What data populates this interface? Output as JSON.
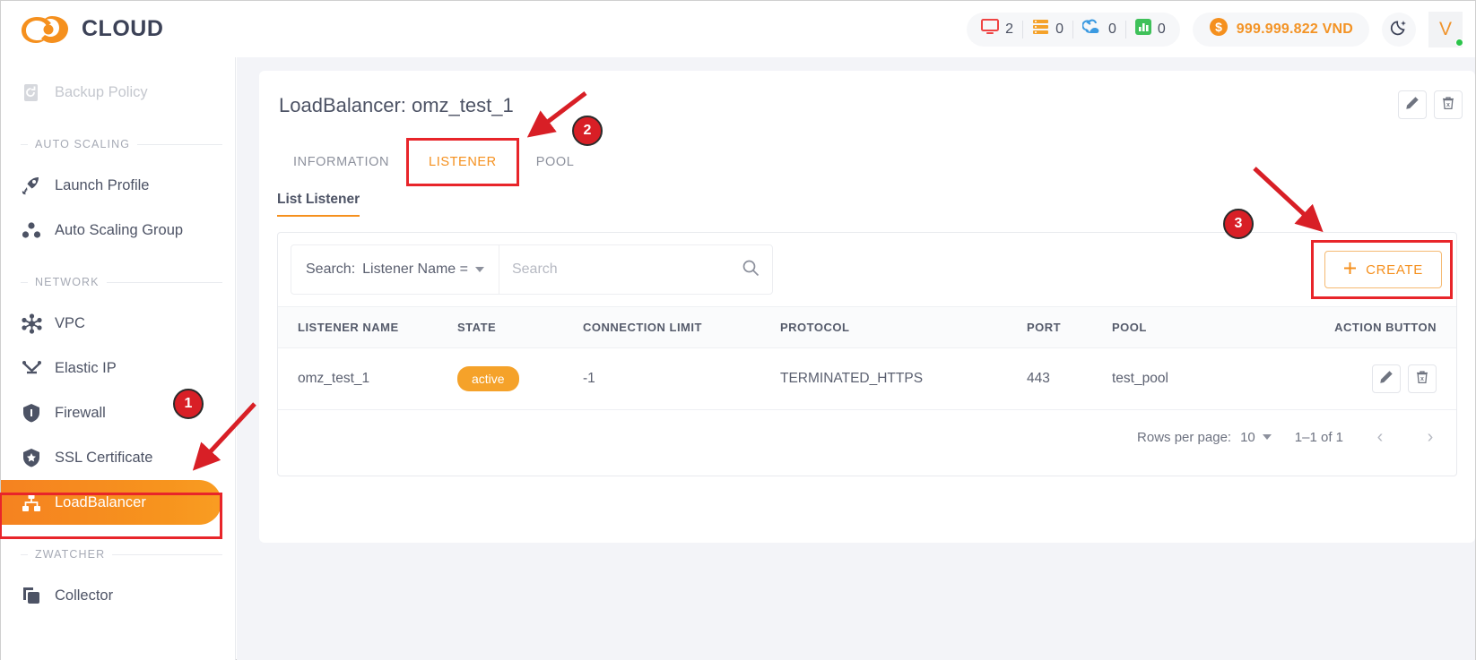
{
  "header": {
    "logo_text": "CLOUD",
    "stats": [
      {
        "icon": "monitor-icon",
        "color": "#ef4444",
        "value": "2"
      },
      {
        "icon": "list-icon",
        "color": "#f5a22a",
        "value": "0"
      },
      {
        "icon": "cloud-sync-icon",
        "color": "#3b9ae1",
        "value": "0"
      },
      {
        "icon": "bar-chart-icon",
        "color": "#3fc15a",
        "value": "0"
      }
    ],
    "balance": "999.999.822 VND",
    "theme_toggle": "moon-icon",
    "avatar_letter": "V"
  },
  "sidebar": {
    "items": [
      {
        "type": "item",
        "label": "Backup Policy",
        "icon": "backup-policy-icon",
        "state": "disabled"
      },
      {
        "type": "section",
        "label": "AUTO SCALING"
      },
      {
        "type": "item",
        "label": "Launch Profile",
        "icon": "rocket-icon",
        "state": "normal"
      },
      {
        "type": "item",
        "label": "Auto Scaling Group",
        "icon": "group-dots-icon",
        "state": "normal"
      },
      {
        "type": "section",
        "label": "NETWORK"
      },
      {
        "type": "item",
        "label": "VPC",
        "icon": "vpc-icon",
        "state": "normal"
      },
      {
        "type": "item",
        "label": "Elastic IP",
        "icon": "elastic-ip-icon",
        "state": "normal"
      },
      {
        "type": "item",
        "label": "Firewall",
        "icon": "shield-icon",
        "state": "normal"
      },
      {
        "type": "item",
        "label": "SSL Certificate",
        "icon": "shield-star-icon",
        "state": "normal"
      },
      {
        "type": "item",
        "label": "LoadBalancer",
        "icon": "loadbalancer-icon",
        "state": "active"
      },
      {
        "type": "section",
        "label": "ZWATCHER"
      },
      {
        "type": "item",
        "label": "Collector",
        "icon": "collector-icon",
        "state": "normal"
      }
    ],
    "active_accent": "#f7941e"
  },
  "main": {
    "card_title": "LoadBalancer: omz_test_1",
    "card_actions": [
      {
        "name": "edit-loadbalancer-button",
        "icon": "pencil-icon"
      },
      {
        "name": "delete-loadbalancer-button",
        "icon": "trash-icon"
      }
    ],
    "tabs": [
      {
        "label": "INFORMATION",
        "active": false
      },
      {
        "label": "LISTENER",
        "active": true
      },
      {
        "label": "POOL",
        "active": false
      }
    ],
    "list_title": "List Listener",
    "search": {
      "label": "Search:",
      "field_selected": "Listener Name =",
      "placeholder": "Search",
      "value": "",
      "icon": "search-icon"
    },
    "create_button": "CREATE",
    "table": {
      "columns": [
        "LISTENER NAME",
        "STATE",
        "CONNECTION LIMIT",
        "PROTOCOL",
        "PORT",
        "POOL",
        "ACTION BUTTON"
      ],
      "rows": [
        {
          "listener_name": "omz_test_1",
          "state": "active",
          "connection_limit": "-1",
          "protocol": "TERMINATED_HTTPS",
          "port": "443",
          "pool": "test_pool"
        }
      ]
    },
    "pagination": {
      "rows_per_page_label": "Rows per page:",
      "rows_per_page_value": "10",
      "range": "1–1 of 1",
      "prev": "‹",
      "next": "›"
    }
  },
  "annotations": {
    "markers": [
      {
        "number": "1",
        "target": "sidebar-item-loadbalancer"
      },
      {
        "number": "2",
        "target": "tab-listener"
      },
      {
        "number": "3",
        "target": "create-button"
      }
    ],
    "color": "#e8252a"
  }
}
